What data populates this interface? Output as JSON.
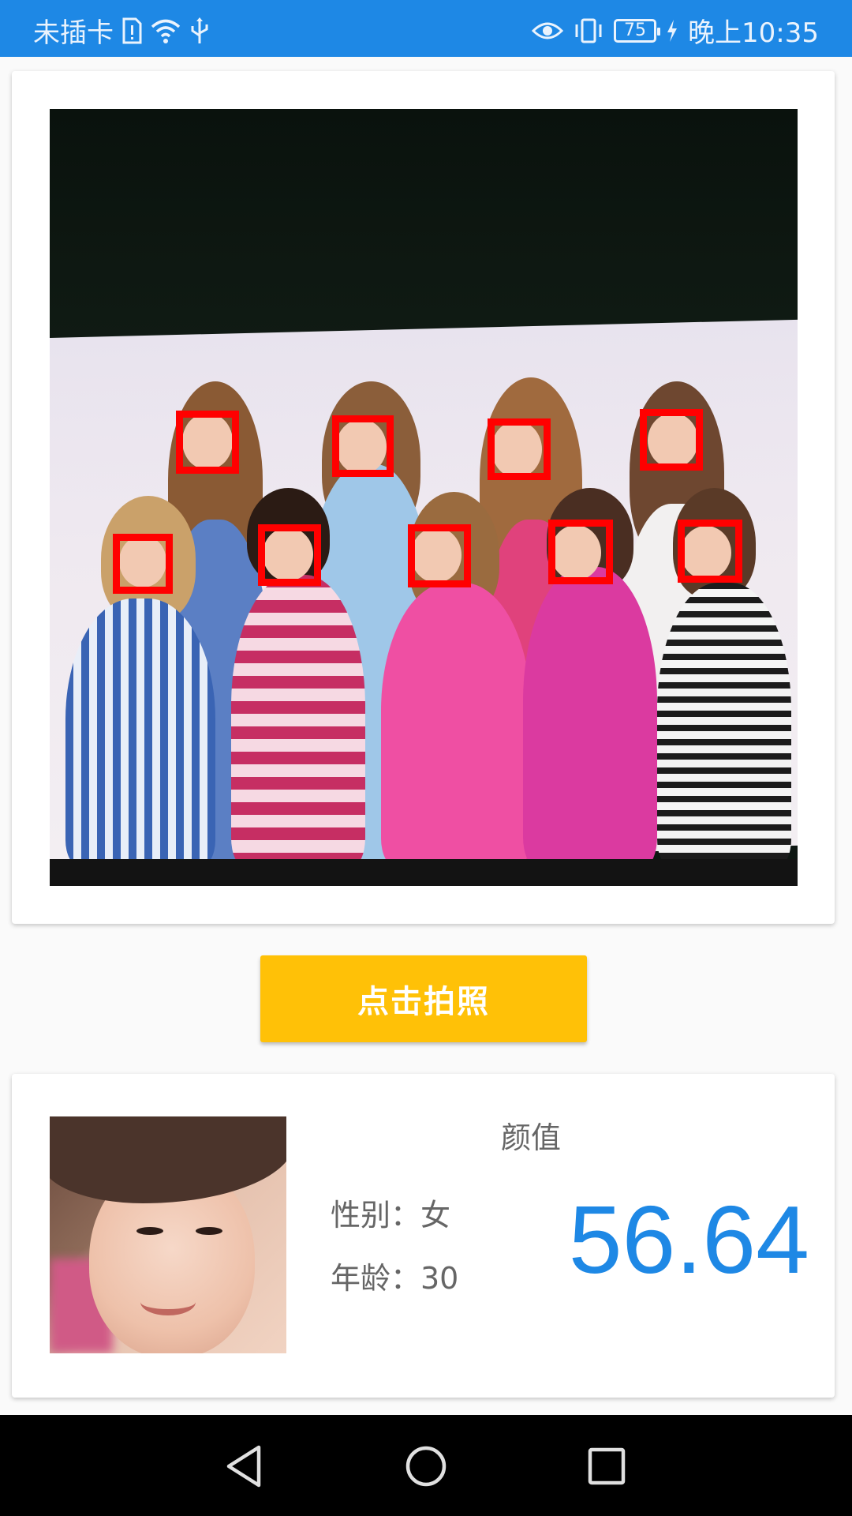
{
  "status_bar": {
    "carrier": "未插卡",
    "battery_level": "75",
    "time": "晚上10:35"
  },
  "photo": {
    "description_icon": "group-photo"
  },
  "capture_button": {
    "label": "点击拍照"
  },
  "result": {
    "score_title": "颜值",
    "gender_label": "性别：女",
    "age_label": "年龄：30",
    "score_value": "56.64"
  },
  "colors": {
    "status_bar": "#1e88e5",
    "accent_button": "#ffc107",
    "score_text": "#1e88e5",
    "face_box": "#ff0000"
  }
}
